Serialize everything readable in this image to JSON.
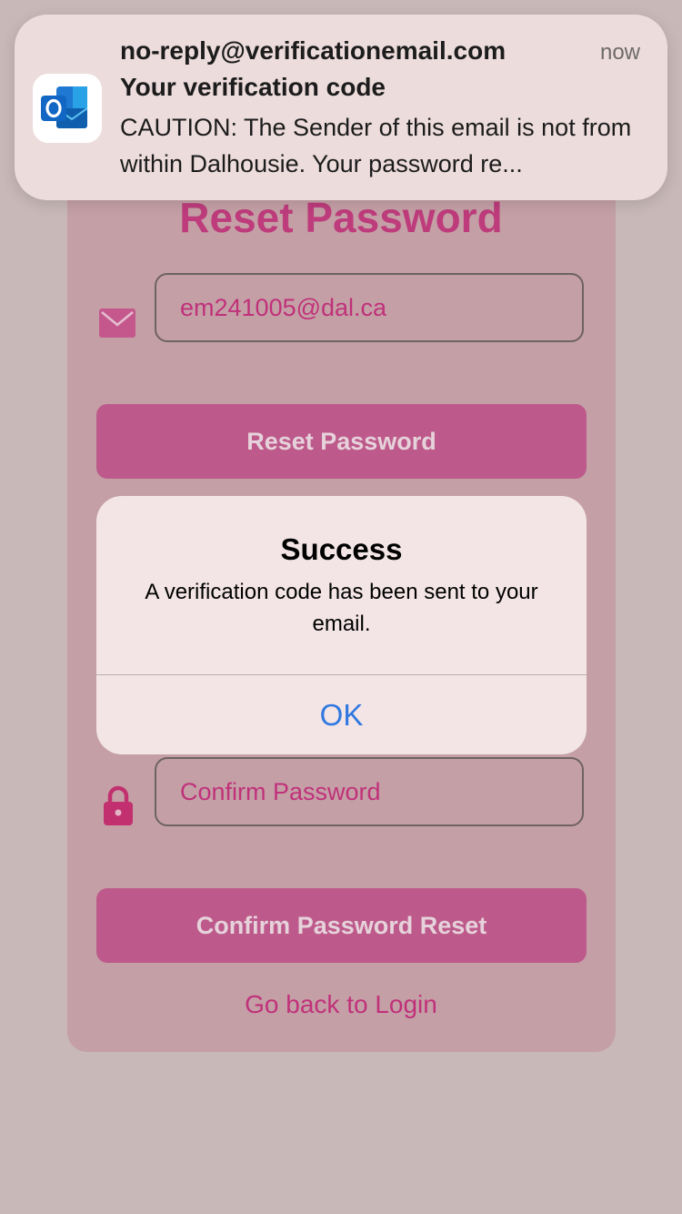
{
  "notification": {
    "sender": "no-reply@verificationemail.com",
    "time": "now",
    "subject": "Your verification code",
    "body": "CAUTION: The Sender of this email is not from within Dalhousie. Your password re...",
    "app_icon": "outlook-icon"
  },
  "form": {
    "title": "Reset Password",
    "email_value": "em241005@dal.ca",
    "email_icon": "mail-icon",
    "reset_button": "Reset Password",
    "confirm_password_placeholder": "Confirm Password",
    "lock_icon": "lock-icon",
    "confirm_button": "Confirm Password Reset",
    "back_link": "Go back to Login"
  },
  "alert": {
    "title": "Success",
    "message": "A verification code has been sent to your email.",
    "ok_label": "OK"
  },
  "colors": {
    "accent": "#be3c7c",
    "button": "#bd5a8b",
    "alert_ok": "#2f78e0"
  }
}
